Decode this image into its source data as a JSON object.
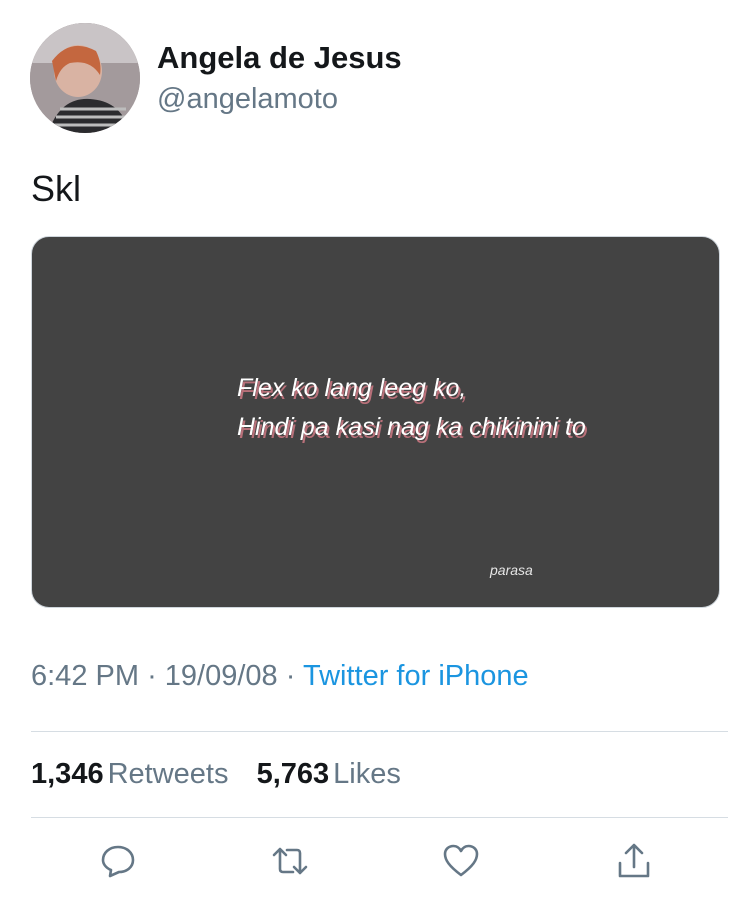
{
  "user": {
    "name": "Angela de Jesus",
    "handle": "@angelamoto"
  },
  "tweet": {
    "text": "Skl"
  },
  "media": {
    "quote_line1": "Flex ko lang leeg ko,",
    "quote_line2": "Hindi pa kasi nag ka chikinini to",
    "watermark": "parasa"
  },
  "meta": {
    "time": "6:42 PM",
    "separator": "·",
    "date": "19/09/08",
    "source": "Twitter for iPhone"
  },
  "stats": {
    "retweets_count": "1,346",
    "retweets_label": "Retweets",
    "likes_count": "5,763",
    "likes_label": "Likes"
  },
  "actions": [
    "reply-icon",
    "retweet-icon",
    "like-icon",
    "share-icon"
  ],
  "colors": {
    "accent": "#1b95e0",
    "secondary_text": "#657786",
    "media_background": "#434343"
  }
}
